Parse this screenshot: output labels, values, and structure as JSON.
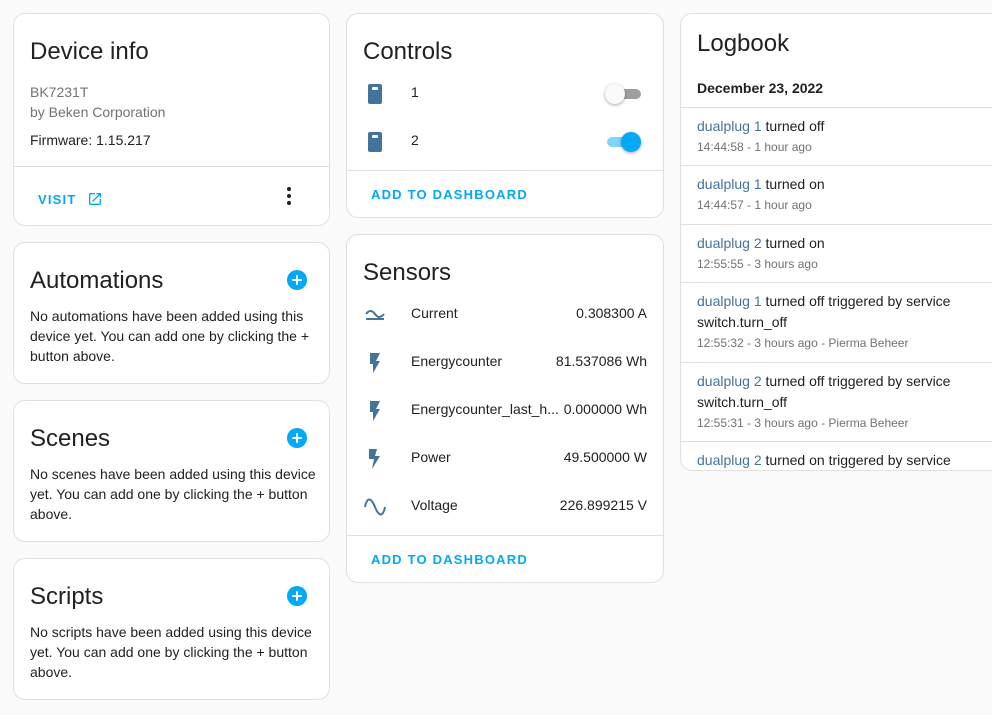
{
  "device_info": {
    "title": "Device info",
    "model": "BK7231T",
    "manufacturer": "by Beken Corporation",
    "firmware": "Firmware: 1.15.217",
    "visit_label": "VISIT"
  },
  "automations": {
    "title": "Automations",
    "empty_text": "No automations have been added using this device yet. You can add one by clicking the + button above."
  },
  "scenes": {
    "title": "Scenes",
    "empty_text": "No scenes have been added using this device yet. You can add one by clicking the + button above."
  },
  "scripts": {
    "title": "Scripts",
    "empty_text": "No scripts have been added using this device yet. You can add one by clicking the + button above."
  },
  "controls": {
    "title": "Controls",
    "items": [
      {
        "name": "1",
        "state": "off"
      },
      {
        "name": "2",
        "state": "on"
      }
    ],
    "add_label": "ADD TO DASHBOARD"
  },
  "sensors": {
    "title": "Sensors",
    "items": [
      {
        "name": "Current",
        "value": "0.308300 A",
        "icon": "current-ac-icon"
      },
      {
        "name": "Energycounter",
        "value": "81.537086 Wh",
        "icon": "flash-icon"
      },
      {
        "name": "Energycounter_last_h...",
        "value": "0.000000 Wh",
        "icon": "flash-icon"
      },
      {
        "name": "Power",
        "value": "49.500000 W",
        "icon": "power-flash-icon"
      },
      {
        "name": "Voltage",
        "value": "226.899215 V",
        "icon": "sine-wave-icon"
      }
    ],
    "add_label": "ADD TO DASHBOARD"
  },
  "logbook": {
    "title": "Logbook",
    "date": "December 23, 2022",
    "entries": [
      {
        "entity": "dualplug 1",
        "text": " turned off",
        "meta": "14:44:58 - 1 hour ago"
      },
      {
        "entity": "dualplug 1",
        "text": " turned on",
        "meta": "14:44:57 - 1 hour ago"
      },
      {
        "entity": "dualplug 2",
        "text": " turned on",
        "meta": "12:55:55 - 3 hours ago"
      },
      {
        "entity": "dualplug 1",
        "text": " turned off triggered by service switch.turn_off",
        "meta": "12:55:32 - 3 hours ago - Pierma Beheer"
      },
      {
        "entity": "dualplug 2",
        "text": " turned off triggered by service switch.turn_off",
        "meta": "12:55:31 - 3 hours ago - Pierma Beheer"
      },
      {
        "entity": "dualplug 2",
        "text": " turned on triggered by service",
        "meta": ""
      }
    ]
  },
  "colors": {
    "accent": "#03a9f4",
    "icon": "#44739e",
    "entity_link": "#44739e"
  }
}
